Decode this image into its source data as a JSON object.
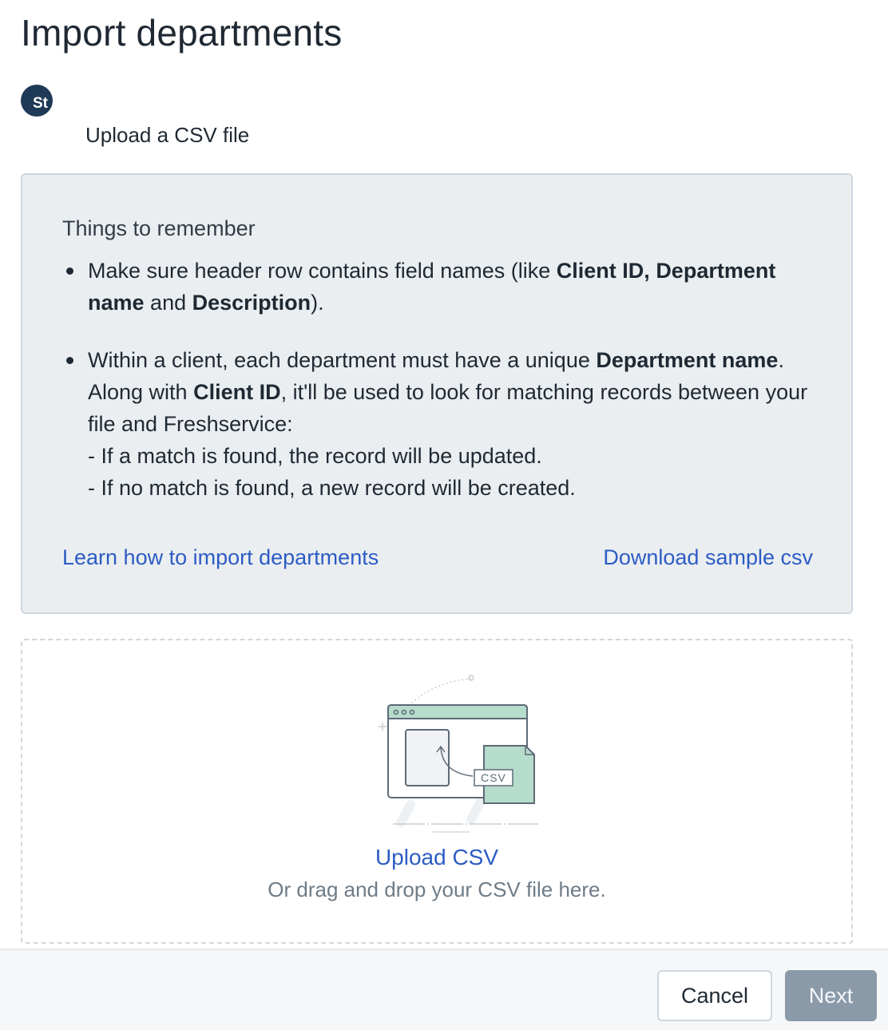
{
  "page": {
    "title": "Import departments"
  },
  "step": {
    "avatar_text": "St",
    "label": "Upload a CSV file"
  },
  "info": {
    "heading": "Things to remember",
    "bullet1": {
      "t1": "Make sure header row contains field names (like ",
      "b1": "Client ID,",
      "b2": "Department name",
      "t2": " and ",
      "b3": "Description",
      "t3": ")."
    },
    "bullet2": {
      "t1": "Within a client, each department must have a unique ",
      "b1": "Department name",
      "t2": ". Along with ",
      "b2": "Client ID",
      "t3": ", it'll be used to look for matching records between your file and Freshservice:",
      "sub1": "- If a match is found, the record will be updated.",
      "sub2": "- If no match is found, a new record will be created."
    },
    "learn_link": "Learn how to import departments",
    "download_link": "Download sample csv"
  },
  "dropzone": {
    "csv_tag": "CSV",
    "upload_label": "Upload CSV",
    "hint": "Or drag and drop your CSV file here."
  },
  "footer": {
    "cancel_label": "Cancel",
    "next_label": "Next"
  },
  "colors": {
    "link": "#2c5cc5",
    "avatar": "#1f3a57",
    "next_disabled": "#8a9aa9",
    "illustration_accent": "#b6dccb"
  },
  "icons": {
    "illustration": "csv-upload-illustration"
  }
}
